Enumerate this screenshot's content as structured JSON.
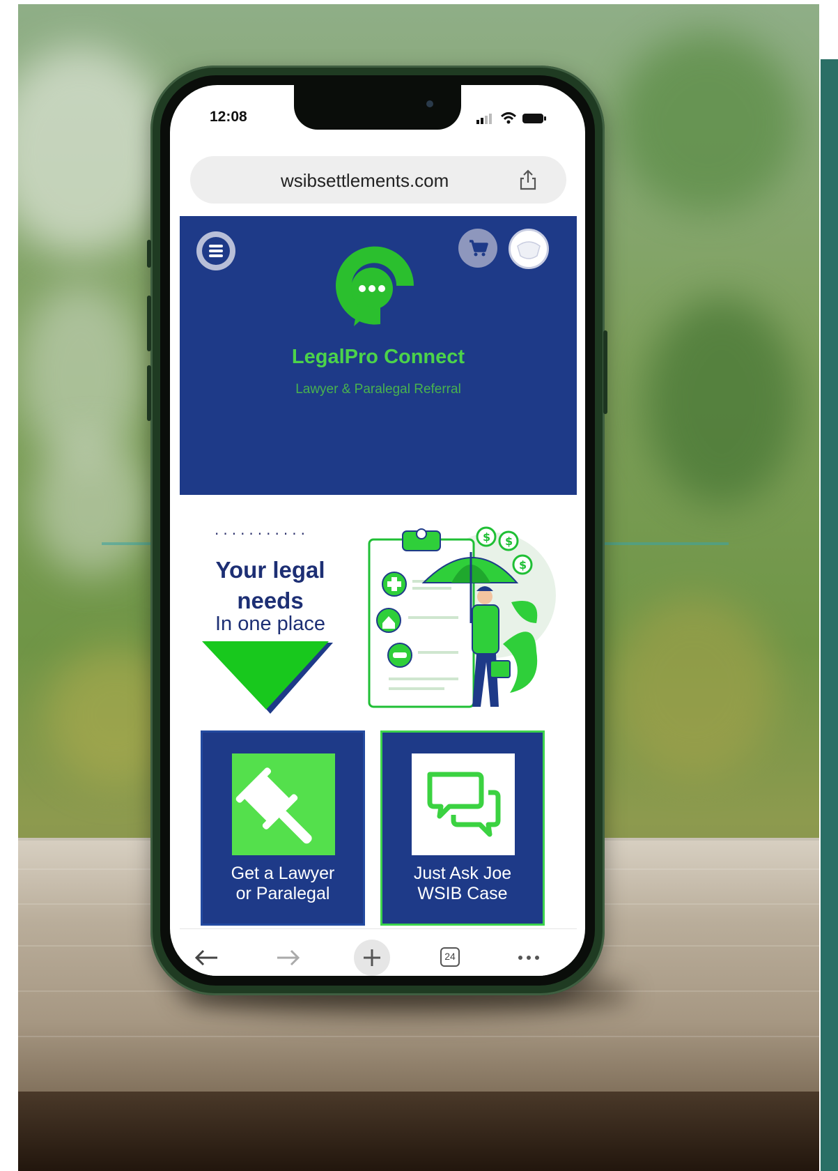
{
  "status": {
    "time": "12:08"
  },
  "browser": {
    "url": "wsibsettlements.com",
    "tabs_count": "24"
  },
  "site": {
    "brand": "LegalPro Connect",
    "tagline": "Lawyer & Paralegal Referral"
  },
  "hero": {
    "title": "Your legal needs",
    "subtitle": "In one place"
  },
  "cards": [
    {
      "label_line1": "Get a Lawyer",
      "label_line2": "or Paralegal",
      "icon": "gavel-icon"
    },
    {
      "label_line1": "Just Ask Joe",
      "label_line2": "WSIB Case",
      "icon": "chat-bubbles-icon"
    }
  ],
  "colors": {
    "brand_blue": "#1e3a88",
    "brand_green": "#4cd34a",
    "background_accent": "#2a6f66"
  }
}
